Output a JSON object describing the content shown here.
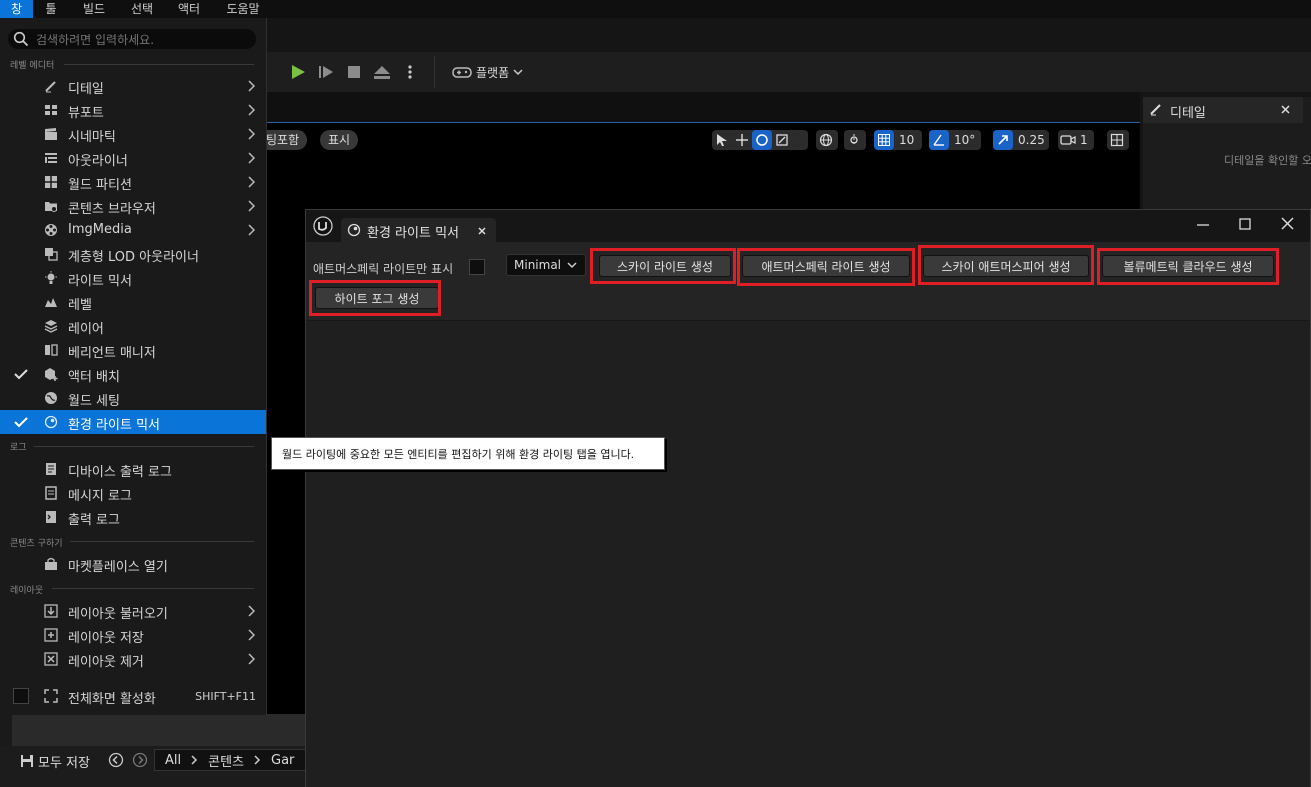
{
  "menubar": {
    "items": [
      {
        "label": "창",
        "active": true
      },
      {
        "label": "툴"
      },
      {
        "label": "빌드"
      },
      {
        "label": "선택"
      },
      {
        "label": "액터"
      },
      {
        "label": "도움말"
      }
    ]
  },
  "toolbar": {
    "platform_label": "플랫폼"
  },
  "viewport": {
    "partial_tab_label": "팅포함",
    "show_label": "표시",
    "grid_value": "10",
    "angle_value": "10°",
    "scale_value": "0.25",
    "camera_value": "1"
  },
  "details_panel": {
    "tab_label": "디테일",
    "hint": "디테일을 확인할 오"
  },
  "window_menu": {
    "search_placeholder": "검색하려면 입력하세요.",
    "sections": {
      "level_editor": "레벨 에디터",
      "log": "로그",
      "content": "콘텐츠 구하기",
      "layout": "레이아웃"
    },
    "items": {
      "details": "디테일",
      "viewports": "뷰포트",
      "cinematics": "시네마틱",
      "outliner": "아웃라이너",
      "world_partition": "월드 파티션",
      "content_browser": "콘텐츠 브라우저",
      "imgmedia": "ImgMedia",
      "hlod_outliner": "계층형 LOD 아웃라이너",
      "light_mixer": "라이트 믹서",
      "levels": "레벨",
      "layers": "레이어",
      "variant_manager": "베리언트 매니저",
      "place_actors": "액터 배치",
      "world_settings": "월드 세팅",
      "env_light_mixer": "환경 라이트 믹서",
      "device_output_log": "디바이스 출력 로그",
      "message_log": "메시지 로그",
      "output_log": "출력 로그",
      "marketplace": "마켓플레이스 열기",
      "load_layout": "레이아웃 불러오기",
      "save_layout": "레이아웃 저장",
      "remove_layout": "레이아웃 제거",
      "fullscreen": "전체화면 활성화",
      "fullscreen_shortcut": "SHIFT+F11"
    }
  },
  "tooltip": {
    "text": "월드 라이팅에 중요한 모든 엔티티를 편집하기 위해 환경 라이팅 탭을 엽니다."
  },
  "content_bar": {
    "save_all": "모두 저장",
    "crumb_all": "All",
    "crumb_content": "콘텐츠",
    "crumb_partial": "Gar"
  },
  "mixer": {
    "tab_label": "환경 라이트 믹서",
    "atmos_only_label": "애트머스페릭 라이트만 표시",
    "mode_value": "Minimal",
    "buttons": {
      "sky_light": "스카이 라이트 생성",
      "atmos_light": "애트머스페릭 라이트 생성",
      "sky_atmosphere": "스카이 애트머스피어 생성",
      "volumetric_cloud": "볼류메트릭 클라우드 생성",
      "height_fog": "하이트 포그 생성"
    },
    "colors": {
      "highlight": "#e01e26",
      "accent": "#0a74d9"
    }
  }
}
